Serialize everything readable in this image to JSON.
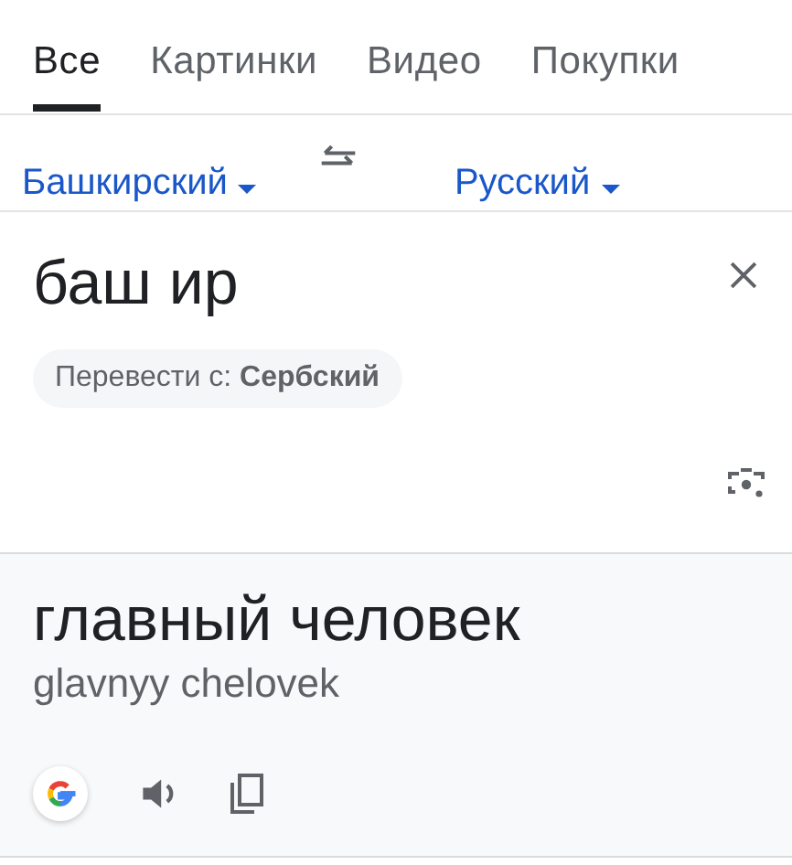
{
  "tabs": [
    {
      "label": "Все",
      "selected": true
    },
    {
      "label": "Картинки",
      "selected": false
    },
    {
      "label": "Видео",
      "selected": false
    },
    {
      "label": "Покупки",
      "selected": false
    }
  ],
  "languages": {
    "source": "Башкирский",
    "target": "Русский"
  },
  "input": {
    "value": "баш ир"
  },
  "suggestion": {
    "text": "Перевести с: **Сербский**"
  },
  "result": {
    "text": "главный человек",
    "transliteration": "glavnyy chelovek"
  }
}
